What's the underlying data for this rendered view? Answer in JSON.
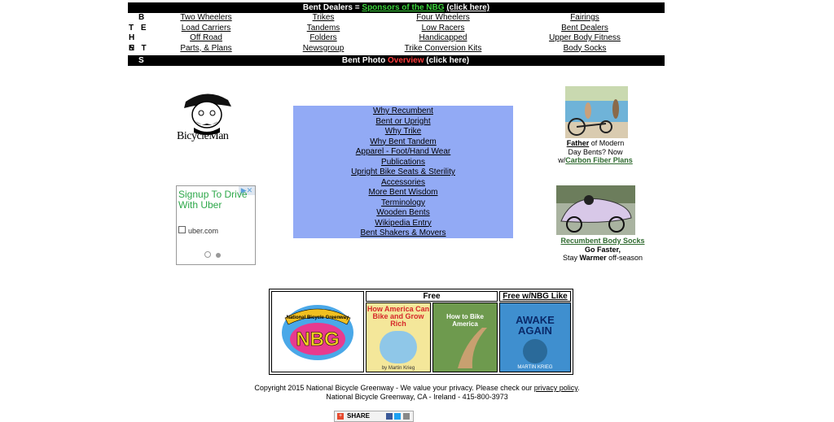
{
  "nav": {
    "top_bar": {
      "prefix": "Bent Dealers = ",
      "sponsors": "Sponsors of the NBG",
      "click": "(click here)"
    },
    "letters": [
      "B",
      "T E",
      "H N",
      "E T",
      "S"
    ],
    "columns": [
      [
        "Two Wheelers",
        "Load Carriers",
        "Off Road",
        "Parts, & Plans"
      ],
      [
        "Trikes",
        "Tandems",
        "Folders",
        "Newsgroup"
      ],
      [
        "Four Wheelers",
        "Low Racers",
        "Handicapped",
        "Trike Conversion Kits"
      ],
      [
        "Fairings",
        "Bent Dealers",
        "Upper Body Fitness",
        "Body Socks"
      ]
    ],
    "bottom_bar": {
      "prefix": "Bent Photo ",
      "overview": "Overview",
      "click": "(click here)"
    }
  },
  "logo": {
    "text": "BicycleMan"
  },
  "ad": {
    "title": "Signup To Drive With Uber",
    "domain": "uber.com"
  },
  "center_links": [
    "Why Recumbent",
    "Bent or Upright",
    "Why Trike",
    "Why Bent Tandem",
    "Apparel - Foot/Hand Wear",
    "Publications",
    "Upright Bike Seats & Sterility",
    "Accessories",
    "More Bent Wisdom",
    "Terminology",
    "Wooden Bents",
    "Wikipedia Entry",
    "Bent Shakers & Movers"
  ],
  "right": {
    "caption1": {
      "father": "Father",
      "rest1": " of Modern",
      "line2": "Day Bents? Now",
      "pre3": "w/",
      "link3": "Carbon Fiber Plans"
    },
    "caption2": {
      "link": "Recumbent Body Socks",
      "line2": "Go Faster,",
      "line3_pre": "Stay ",
      "warmer": "Warmer",
      "line3_post": " off-season"
    }
  },
  "books": {
    "header_free": "Free",
    "header_like": "Free w/NBG Like",
    "logo_text": "NBG",
    "logo_ring": "National Bicycle Greenway",
    "book1": {
      "title": "How America Can Bike and Grow Rich",
      "author": "by Martin Krieg"
    },
    "book2": {
      "title": "How to Bike America"
    },
    "book3": {
      "title": "AWAKE AGAIN",
      "author": "MARTIN KRIEG"
    }
  },
  "footer": {
    "line1_pre": "Copyright 2015 National Bicycle Greenway -  We value your privacy.  Please check our ",
    "privacy": "privacy policy",
    "line1_post": ".",
    "line2": "National Bicycle Greenway, CA - Ireland - 415-800-3973",
    "share": "SHARE"
  },
  "colors": {
    "link_box": "#92aaf5",
    "green": "#3bd43b",
    "red": "#ff3b3b"
  }
}
